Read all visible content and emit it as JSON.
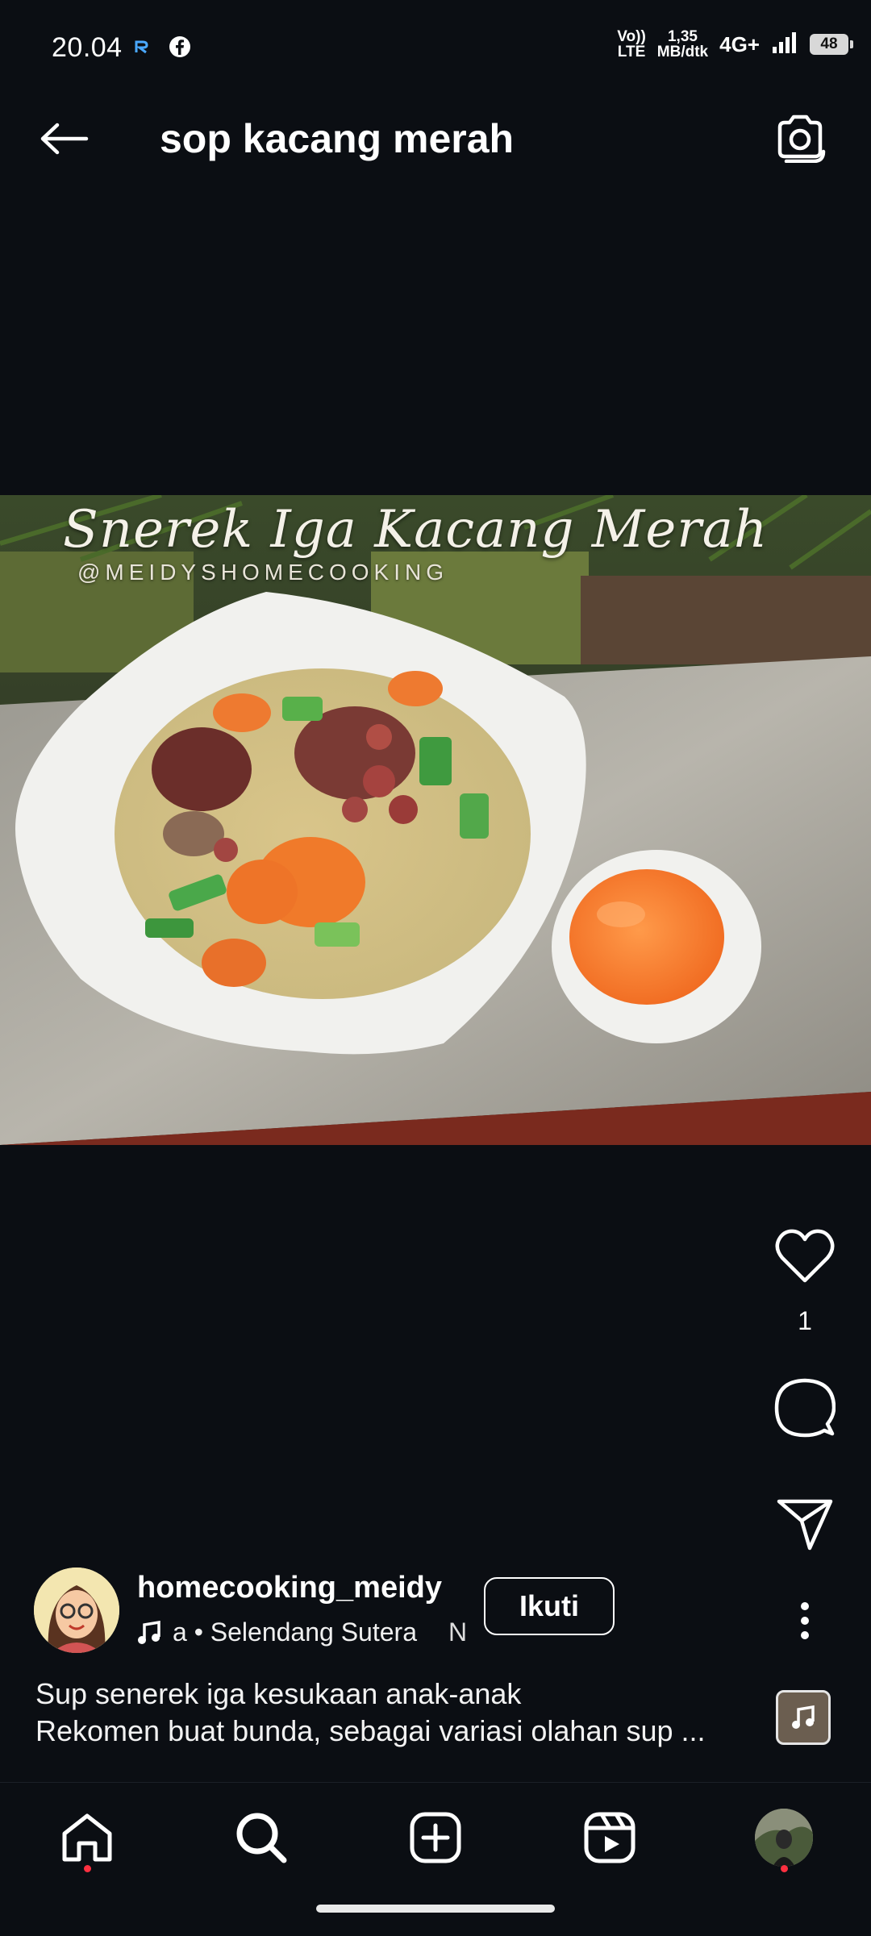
{
  "status_bar": {
    "time": "20.04",
    "volte_top": "Vo))",
    "volte_bottom": "LTE",
    "speed_value": "1,35",
    "speed_unit": "MB/dtk",
    "network": "4G+",
    "battery": "48"
  },
  "header": {
    "title": "sop kacang merah"
  },
  "post": {
    "image_overlay_title": "Snerek Iga Kacang Merah",
    "image_overlay_handle": "@MEIDYSHOMECOOKING",
    "like_count": "1",
    "username": "homecooking_meidy",
    "audio_label": "a • Selendang Sutera",
    "audio_overflow": "N",
    "follow_label": "Ikuti",
    "caption_line1": "Sup senerek iga kesukaan anak-anak",
    "caption_line2": "Rekomen buat bunda, sebagai variasi olahan sup ..."
  },
  "colors": {
    "background": "#0b0e13",
    "notification_dot": "#ff3040"
  },
  "icons": [
    "back-arrow-icon",
    "camera-icon",
    "heart-icon",
    "comment-icon",
    "share-icon",
    "more-vertical-icon",
    "music-note-icon",
    "home-icon",
    "search-icon",
    "create-icon",
    "reels-icon"
  ]
}
